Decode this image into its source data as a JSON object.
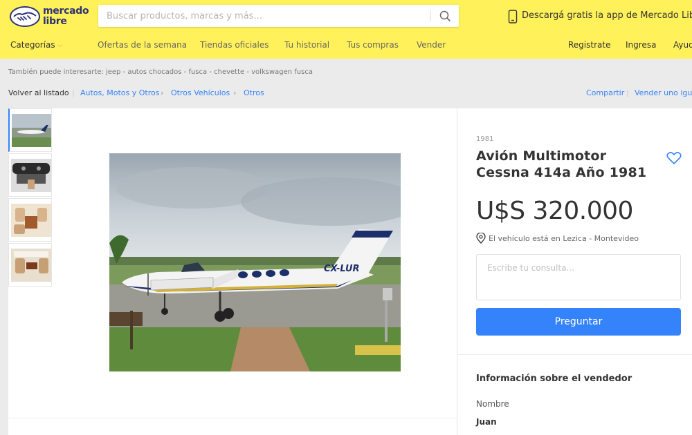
{
  "header": {
    "logo": {
      "line1": "mercado",
      "line2": "libre"
    },
    "search": {
      "placeholder": "Buscar productos, marcas y más..."
    },
    "app_promo": "Descargá gratis la app de Mercado Libre",
    "nav": {
      "categories": "Categorías",
      "offers": "Ofertas de la semana",
      "stores": "Tiendas oficiales",
      "history": "Tu historial",
      "purchases": "Tus compras",
      "sell": "Vender",
      "register": "Registrate",
      "login": "Ingresa",
      "help": "Ayuda"
    },
    "brand_color": "#fff159"
  },
  "related": "También puede interesarte: jeep - autos chocados - fusca - chevette - volkswagen fusca",
  "breadcrumb": {
    "back": "Volver al listado",
    "items": [
      "Autos, Motos y Otros",
      "Otros Vehículos",
      "Otros"
    ],
    "share": "Compartir",
    "sell_same": "Vender uno igual"
  },
  "gallery": {
    "thumbnails": [
      "plane-exterior-thumb",
      "cockpit-thumb",
      "cabin-seats-thumb",
      "cabin-interior-thumb"
    ],
    "active_index": 0,
    "main_image": "airplane-photo",
    "registration": "CX-LUR"
  },
  "listing": {
    "year": "1981",
    "title": "Avión Multimotor Cessna 414a Año 1981",
    "price": "U$S 320.000",
    "location": "El vehículo está en Lezica - Montevideo",
    "query_placeholder": "Escribe tu consulta...",
    "ask_button": "Preguntar",
    "accent_color": "#3483fa"
  },
  "seller": {
    "heading": "Información sobre el vendedor",
    "name_label": "Nombre",
    "name": "Juan"
  }
}
